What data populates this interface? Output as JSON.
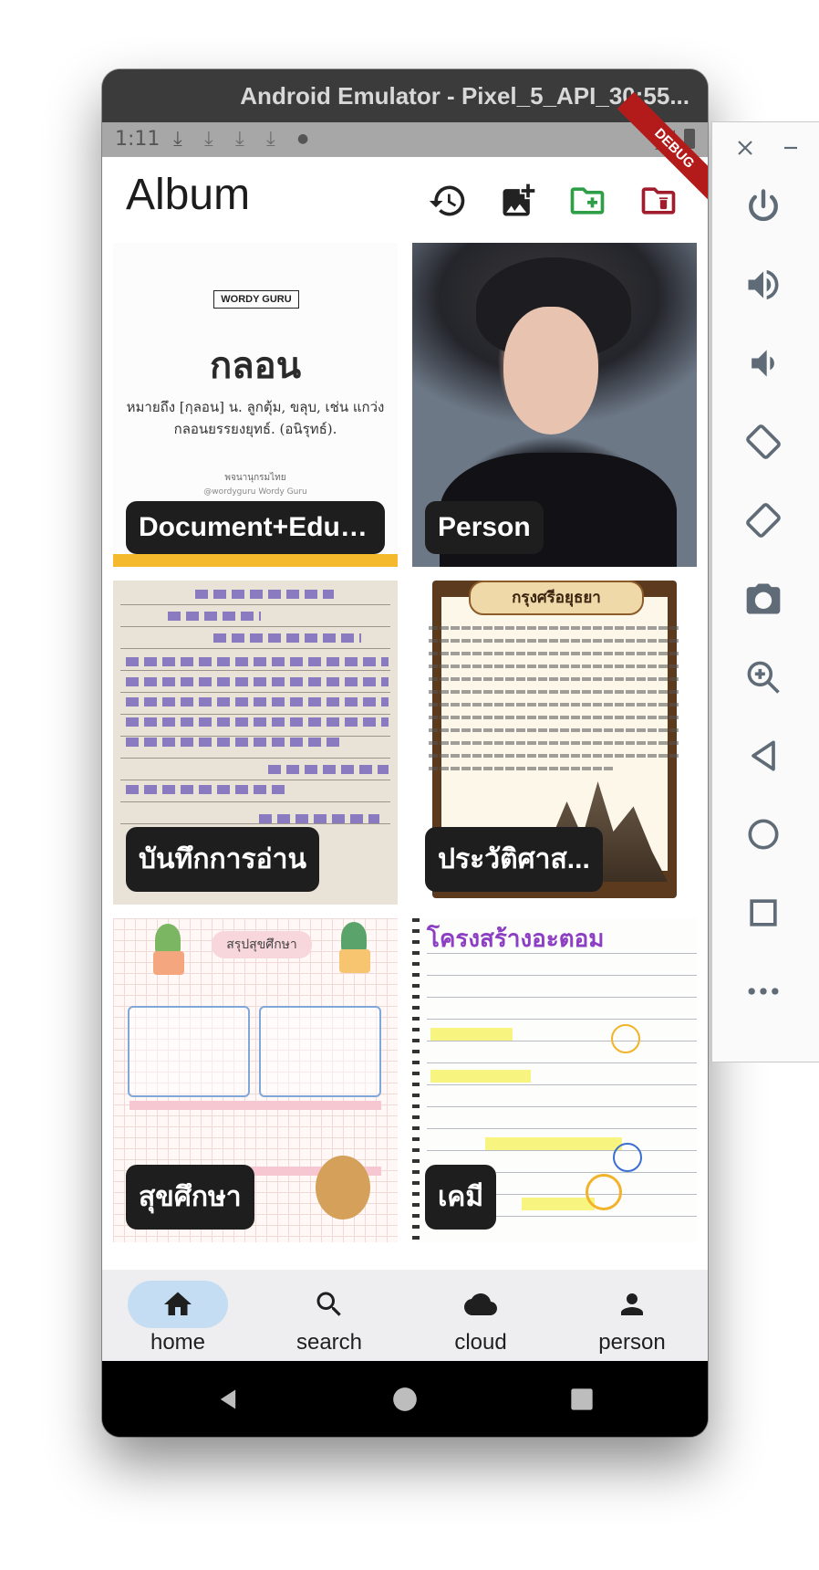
{
  "window": {
    "title": "Android Emulator - Pixel_5_API_30:55..."
  },
  "status_bar": {
    "time": "1:11",
    "debug_banner": "DEBUG"
  },
  "app_bar": {
    "title": "Album",
    "actions": [
      "history-icon",
      "add-photo-icon",
      "create-folder-icon",
      "delete-folder-icon"
    ],
    "colors": {
      "create_folder": "#2e9e47",
      "delete_folder": "#a11d2d"
    }
  },
  "albums": [
    {
      "label": "Document+Educ...",
      "thumb": {
        "brand": "WORDY GURU",
        "word": "กลอน",
        "definition": "หมายถึง  [กฺลอน] น. ลูกตุ้ม, ขลุบ, เช่น แกว่งกลอนยรรยงยุทธ์. (อนิรุทธ์).",
        "footer": "พจนานุกรมไทย",
        "social": "@wordyguru   Wordy Guru"
      }
    },
    {
      "label": "Person"
    },
    {
      "label": "บันทึกการอ่าน"
    },
    {
      "label": "ประวัติศาส...",
      "thumb": {
        "title": "กรุงศรีอยุธยา"
      }
    },
    {
      "label": "สุขศึกษา",
      "thumb": {
        "title": "สรุปสุขศึกษา"
      }
    },
    {
      "label": "เคมี",
      "thumb": {
        "title": "โครงสร้างอะตอม"
      }
    }
  ],
  "bottom_nav": [
    {
      "label": "home",
      "icon": "home-icon",
      "selected": true
    },
    {
      "label": "search",
      "icon": "search-icon",
      "selected": false
    },
    {
      "label": "cloud",
      "icon": "cloud-icon",
      "selected": false
    },
    {
      "label": "person",
      "icon": "person-icon",
      "selected": false
    }
  ],
  "colors": {
    "nav_selected_pill": "#c4ddf2",
    "doc_stripe": "#f4b92d",
    "label_bg": "#1e1e1e"
  },
  "emulator_toolbar": [
    "close-icon",
    "minimize-icon",
    "power-icon",
    "volume-up-icon",
    "volume-down-icon",
    "rotate-left-icon",
    "rotate-right-icon",
    "screenshot-icon",
    "zoom-icon",
    "back-icon",
    "home-circle-icon",
    "overview-icon",
    "more-icon"
  ]
}
